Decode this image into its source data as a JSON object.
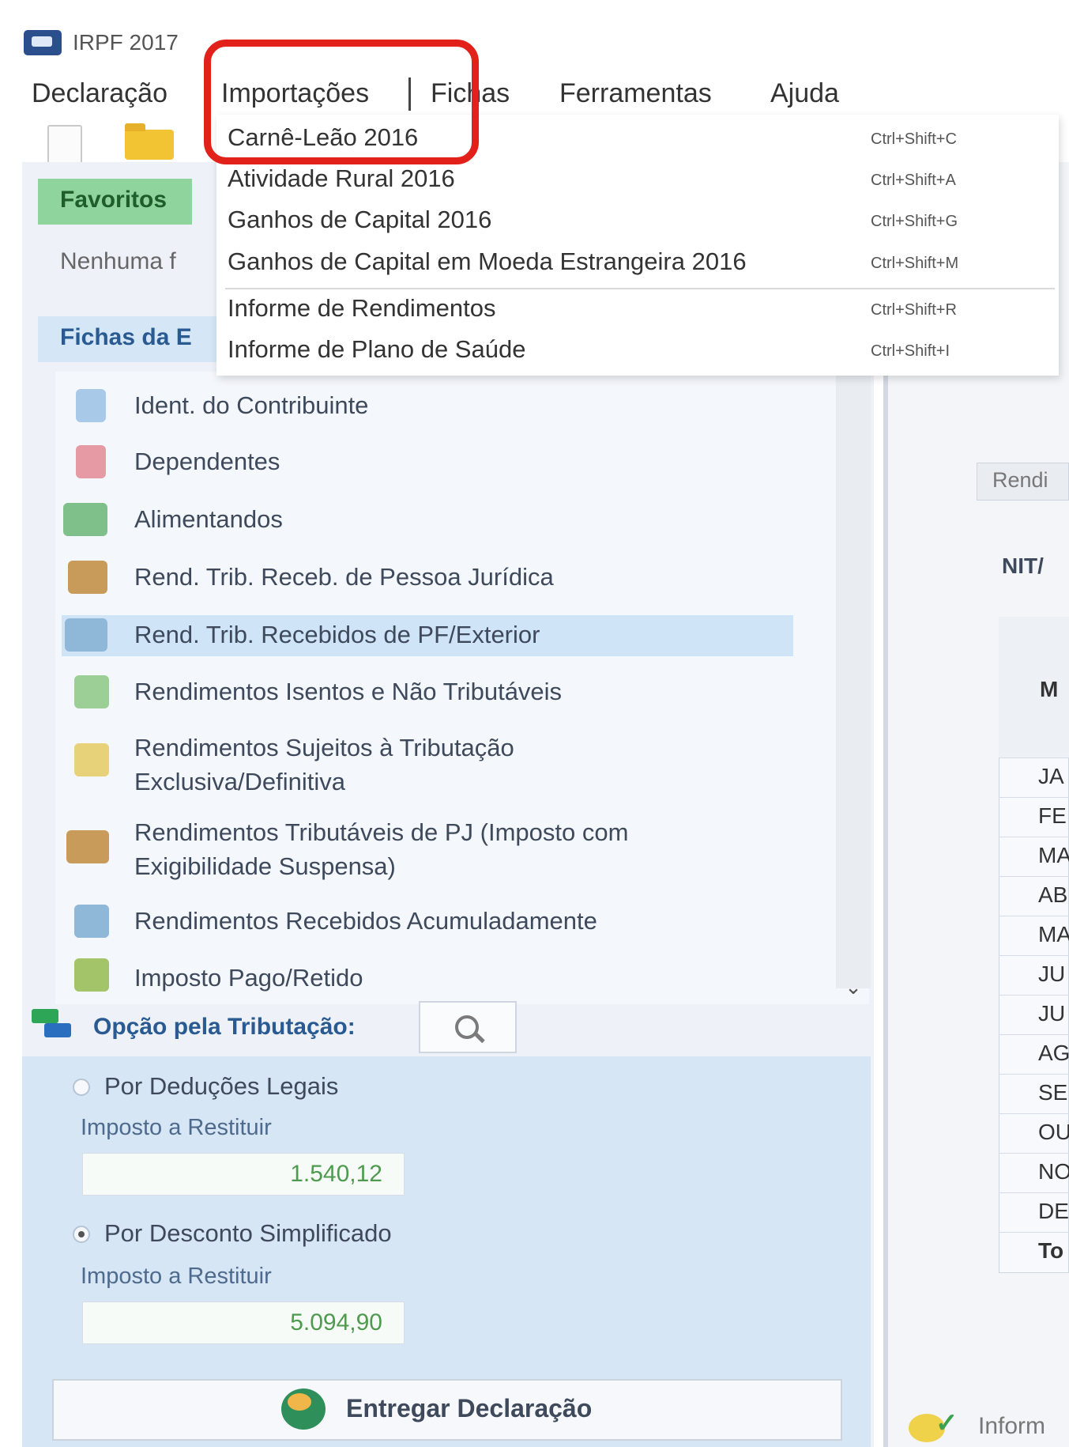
{
  "window": {
    "title": "IRPF 2017"
  },
  "menubar": {
    "items": [
      "Declaração",
      "Importações",
      "Fichas",
      "Ferramentas",
      "Ajuda"
    ]
  },
  "importacoes_menu": {
    "items": [
      {
        "label": "Carnê-Leão 2016",
        "shortcut": "Ctrl+Shift+C"
      },
      {
        "label": "Atividade Rural 2016",
        "shortcut": "Ctrl+Shift+A"
      },
      {
        "label": "Ganhos de Capital 2016",
        "shortcut": "Ctrl+Shift+G"
      },
      {
        "label": "Ganhos de Capital em Moeda Estrangeira 2016",
        "shortcut": "Ctrl+Shift+M"
      },
      {
        "label": "Informe de Rendimentos",
        "shortcut": "Ctrl+Shift+R"
      },
      {
        "label": "Informe de Plano de Saúde",
        "shortcut": "Ctrl+Shift+I"
      }
    ]
  },
  "favoritos": {
    "header": "Favoritos",
    "empty_text": "Nenhuma f"
  },
  "fichas": {
    "header": "Fichas da E",
    "items": [
      {
        "label": "Ident. do Contribuinte",
        "icon": "person-icon"
      },
      {
        "label": "Dependentes",
        "icon": "dependents-icon"
      },
      {
        "label": "Alimentandos",
        "icon": "alimentandos-icon"
      },
      {
        "label": "Rend. Trib. Receb. de Pessoa Jurídica",
        "icon": "company-income-icon"
      },
      {
        "label": "Rend. Trib. Recebidos de PF/Exterior",
        "icon": "person-income-icon"
      },
      {
        "label": "Rendimentos Isentos e Não Tributáveis",
        "icon": "exempt-income-icon"
      },
      {
        "label": "Rendimentos Sujeitos à Tributação",
        "label2": "Exclusiva/Definitiva",
        "icon": "exclusive-tax-icon"
      },
      {
        "label": "Rendimentos Tributáveis de PJ (Imposto com",
        "label2": "Exigibilidade Suspensa)",
        "icon": "suspended-tax-icon"
      },
      {
        "label": "Rendimentos Recebidos Acumuladamente",
        "icon": "accumulated-income-icon"
      },
      {
        "label": "Imposto Pago/Retido",
        "icon": "tax-paid-icon"
      }
    ],
    "selected_index": 4
  },
  "tributacao": {
    "header": "Opção pela Tributação:",
    "options": [
      {
        "label": "Por Deduções Legais",
        "sub_label": "Imposto a Restituir",
        "value": "1.540,12",
        "selected": false
      },
      {
        "label": "Por Desconto Simplificado",
        "sub_label": "Imposto a Restituir",
        "value": "5.094,90",
        "selected": true
      }
    ]
  },
  "submit": {
    "label": "Entregar Declaração"
  },
  "right_panel": {
    "tab_label": "Rendi",
    "nit_label": "NIT/",
    "table_header": "M",
    "rows": [
      "JA",
      "FE",
      "MA",
      "AB",
      "MA",
      "JU",
      "JU",
      "AG",
      "SE",
      "OU",
      "NO",
      "DE",
      "To"
    ],
    "footer_label": "Inform"
  },
  "colors": {
    "highlight_box": "#e3211b",
    "favoritos_header": "#8fd49d",
    "fichas_header": "#d5e6f6",
    "selected_row": "#cfe4f7",
    "value_text": "#4e9a4e"
  }
}
